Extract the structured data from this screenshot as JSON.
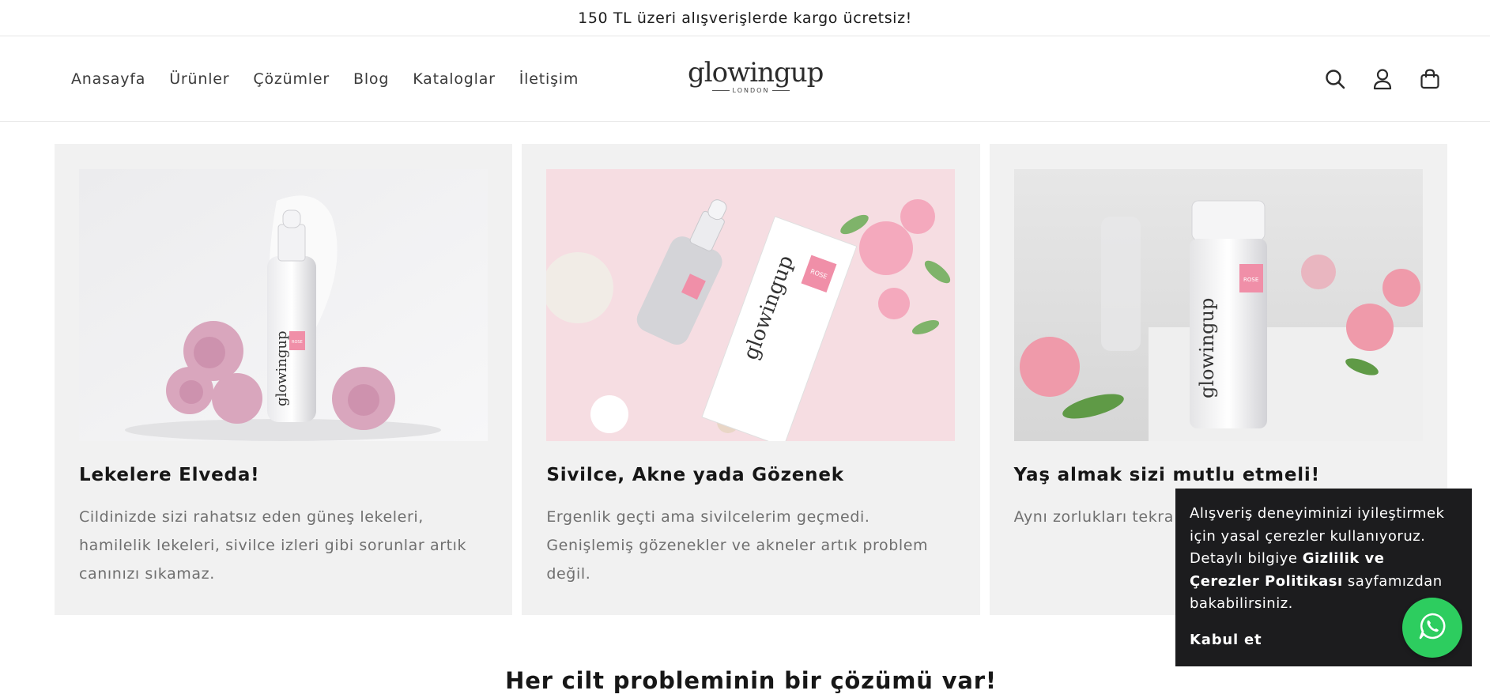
{
  "announcement": {
    "text": "150 TL üzeri alışverişlerde kargo ücretsiz!"
  },
  "nav": {
    "items": [
      {
        "label": "Anasayfa"
      },
      {
        "label": "Ürünler"
      },
      {
        "label": "Çözümler"
      },
      {
        "label": "Blog"
      },
      {
        "label": "Kataloglar"
      },
      {
        "label": "İletişim"
      }
    ]
  },
  "logo": {
    "word": "glowingup",
    "sub": "LONDON"
  },
  "header_icons": [
    "search-icon",
    "account-icon",
    "cart-icon"
  ],
  "cards": [
    {
      "title": "Lekelere Elveda!",
      "text": "Cildinizde sizi rahatsız eden güneş lekeleri, hamilelik lekeleri, sivilce izleri gibi sorunlar artık canınızı sıkamaz.",
      "product": {
        "brand": "glowingup",
        "tag": "ROSE"
      }
    },
    {
      "title": "Sivilce, Akne yada Gözenek",
      "text": "Ergenlik geçti ama sivilcelerim geçmedi. Genişlemiş gözenekler ve akneler artık problem değil.",
      "product": {
        "brand": "glowingup",
        "tag": "ROSE"
      }
    },
    {
      "title": "Yaş almak sizi mutlu etmeli!",
      "text": "Aynı zorlukları tekra ama yaşlanmak da i",
      "product": {
        "brand": "glowingup",
        "tag": "ROSE"
      }
    }
  ],
  "section": {
    "title": "Her cilt probleminin bir çözümü var!"
  },
  "cookie": {
    "text_before": "Alışveriş deneyiminizi iyileştirmek için yasal çerezler kullanıyoruz. Detaylı bilgiye ",
    "link": "Gizlilik ve Çerezler Politikası",
    "text_after": " sayfamızdan bakabilirsiniz.",
    "accept": "Kabul et"
  },
  "colors": {
    "whatsapp": "#2dcd5f",
    "cookie_bg": "#1c1c1e",
    "card_bg": "#f1f1f1",
    "brand_pink": "#f08fa8"
  }
}
